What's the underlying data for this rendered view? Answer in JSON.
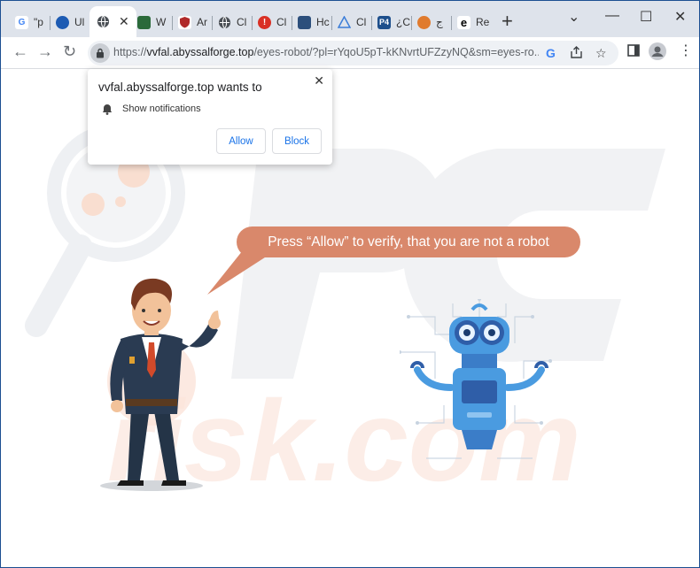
{
  "browser": {
    "tabs": [
      {
        "label": "\"p",
        "icon": "google-icon"
      },
      {
        "label": "Ul",
        "icon": "circle-logo-icon"
      },
      {
        "label": "",
        "icon": "globe-icon",
        "active": true
      },
      {
        "label": "W",
        "icon": "grid-icon"
      },
      {
        "label": "Ar",
        "icon": "shield-icon"
      },
      {
        "label": "Cl",
        "icon": "globe-icon"
      },
      {
        "label": "Cl",
        "icon": "warning-icon"
      },
      {
        "label": "Hc",
        "icon": "monitor-icon"
      },
      {
        "label": "Cl",
        "icon": "triangle-icon"
      },
      {
        "label": "¿C",
        "icon": "p4-icon"
      },
      {
        "label": "ج",
        "icon": "orange-circle-icon"
      },
      {
        "label": "Re",
        "icon": "edge-icon"
      }
    ],
    "new_tab": "+",
    "url_host": "vvfal.abyssalforge.top",
    "url_prefix": "https://",
    "url_rest": "/eyes-robot/?pl=rYqoU5pT-kKNvrtUFZzyNQ&sm=eyes-ro..."
  },
  "popup": {
    "title": "vvfal.abyssalforge.top wants to",
    "permission": "Show notifications",
    "allow_label": "Allow",
    "block_label": "Block",
    "close": "✕"
  },
  "page": {
    "bubble_text": "Press “Allow” to verify, that you are not a robot",
    "watermark": "risk.com"
  },
  "colors": {
    "bubble": "#d9886b",
    "robot_blue": "#4a9be0",
    "frame": "#1c4f91"
  }
}
